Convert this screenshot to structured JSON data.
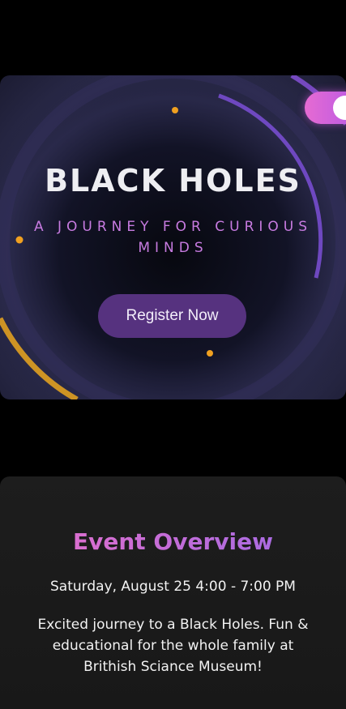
{
  "hero": {
    "title": "BLACK HOLES",
    "subtitle": "A JOURNEY FOR CURIOUS MINDS",
    "register_label": "Register Now"
  },
  "overview": {
    "title": "Event Overview",
    "date": "Saturday, August 25 4:00 - 7:00 PM",
    "description": "Excited journey to a Black Holes. Fun & educational for the whole family at Brithish Sciance Museum!"
  },
  "colors": {
    "accent_pink": "#e66bd2",
    "accent_purple": "#9b6ae8",
    "button_bg": "#56327f",
    "ring_gold": "#e0a020",
    "ring_violet": "#7b4fd6"
  },
  "icons": {
    "toggle": "theme-toggle-icon"
  }
}
